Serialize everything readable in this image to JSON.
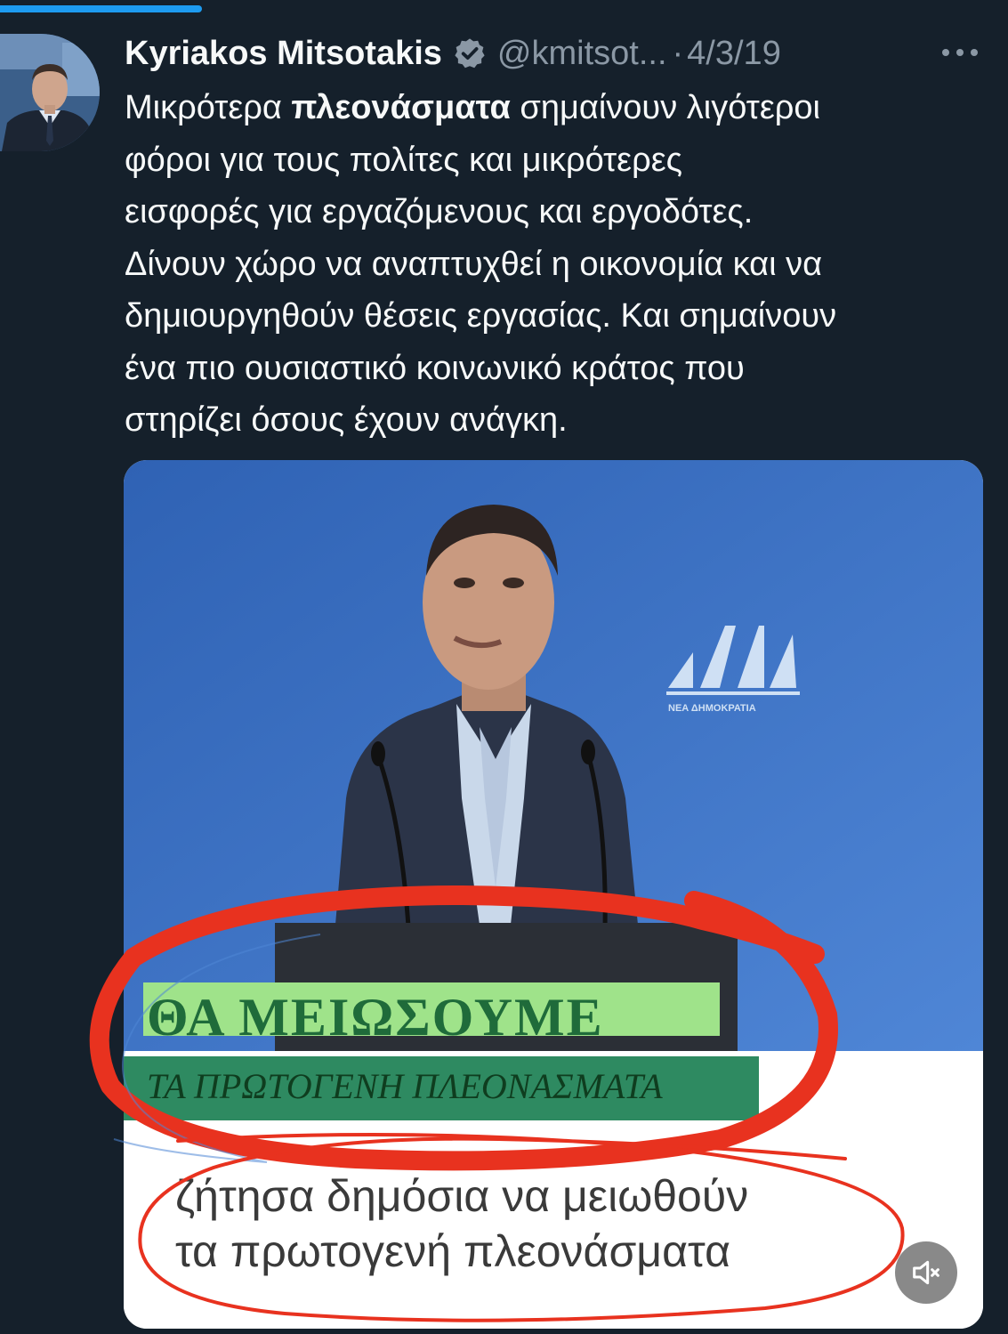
{
  "scroll_progress": 0.2,
  "colors": {
    "background": "#15202b",
    "progress": "#1d9bf0",
    "verified": "#8b98a5",
    "annotation": "#e8321f"
  },
  "tweet": {
    "author": "Kyriakos Mitsotakis",
    "handle": "@kmitsot...",
    "separator": "·",
    "date": "4/3/19",
    "text_lines": [
      {
        "bold": "",
        "rest": "Μικρότερα "
      },
      "φόροι για τους πολίτες και μικρότερες",
      "εισφορές για εργαζόμενους και εργοδότες.",
      "Δίνουν χώρο να αναπτυχθεί η οικονομία και να",
      "δημιουργηθούν θέσεις εργασίας. Και σημαίνουν",
      "ένα πιο ουσιαστικό κοινωνικό κράτος που",
      "στηρίζει όσους έχουν ανάγκη."
    ],
    "first_line": {
      "before": "Μικρότερα ",
      "bold": "πλεονάσματα",
      "after": " σημαίνουν λιγότεροι"
    }
  },
  "media": {
    "headline": "ΘΑ ΜΕΙΩΣΟΥΜΕ",
    "subheadline": "ΤΑ ΠΡΩΤΟΓΕΝΗ ΠΛΕΟΝΑΣΜΑΤΑ",
    "quote_line_1": "ζήτησα δημόσια να μειωθούν",
    "quote_line_2": "τα πρωτογενή πλεονάσματα",
    "logo_subtext": "ΝΕΑ ΔΗΜΟΚΡΑΤΙΑ",
    "mute_icon": "speaker-muted-icon"
  }
}
